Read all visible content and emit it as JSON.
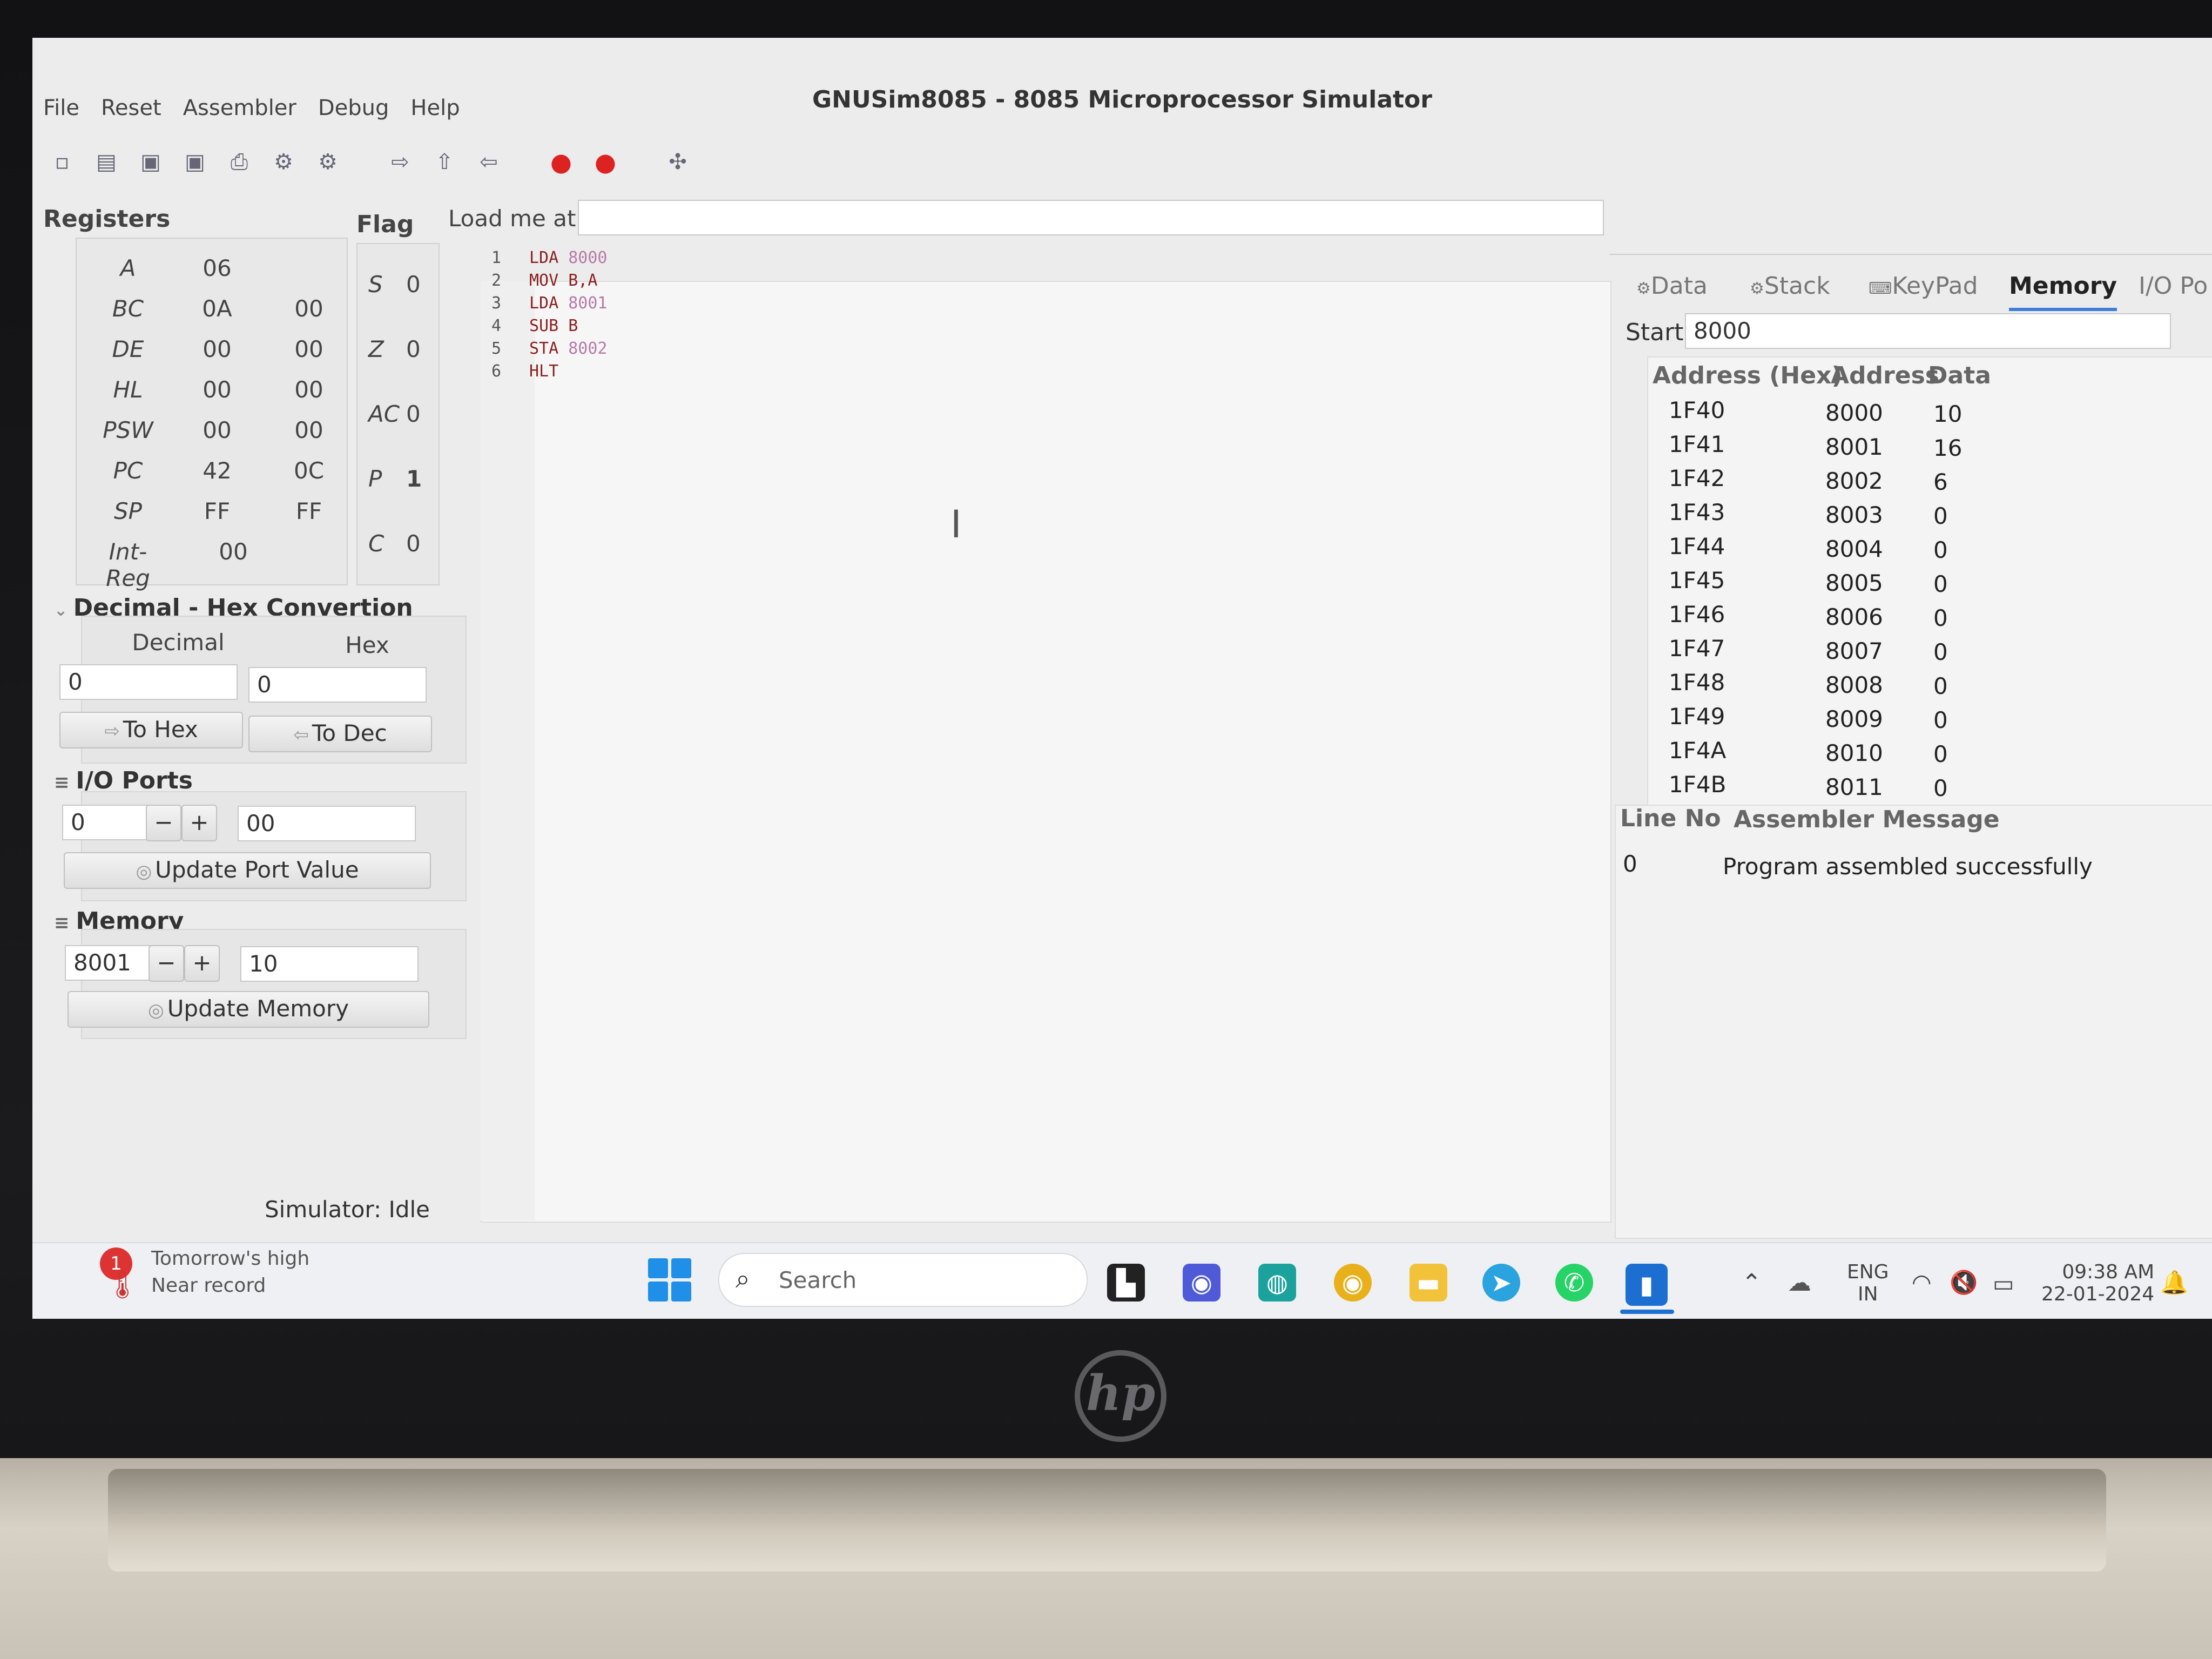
{
  "window": {
    "title": "GNUSim8085 - 8085 Microprocessor Simulator",
    "menu": [
      "File",
      "Reset",
      "Assembler",
      "Debug",
      "Help"
    ]
  },
  "registers": {
    "title": "Registers",
    "rows": [
      {
        "name": "A",
        "v1": "06",
        "v2": ""
      },
      {
        "name": "BC",
        "v1": "0A",
        "v2": "00"
      },
      {
        "name": "DE",
        "v1": "00",
        "v2": "00"
      },
      {
        "name": "HL",
        "v1": "00",
        "v2": "00"
      },
      {
        "name": "PSW",
        "v1": "00",
        "v2": "00"
      },
      {
        "name": "PC",
        "v1": "42",
        "v2": "0C"
      },
      {
        "name": "SP",
        "v1": "FF",
        "v2": "FF"
      },
      {
        "name": "Int-Reg",
        "v1": "00",
        "v2": ""
      }
    ]
  },
  "flags": {
    "title": "Flag",
    "rows": [
      {
        "name": "S",
        "value": "0"
      },
      {
        "name": "Z",
        "value": "0"
      },
      {
        "name": "AC",
        "value": "0"
      },
      {
        "name": "P",
        "value": "1"
      },
      {
        "name": "C",
        "value": "0"
      }
    ]
  },
  "conversion": {
    "title": "Decimal - Hex Convertion",
    "decimal_label": "Decimal",
    "hex_label": "Hex",
    "decimal_value": "0",
    "hex_value": "0",
    "to_hex": "To Hex",
    "to_dec": "To Dec"
  },
  "io_ports": {
    "title": "I/O Ports",
    "port": "0",
    "minus": "−",
    "plus": "+",
    "value": "00",
    "update": "Update Port Value"
  },
  "memory_panel": {
    "title": "Memory",
    "address": "8001",
    "minus": "−",
    "plus": "+",
    "value": "10",
    "update": "Update Memory"
  },
  "editor": {
    "load_label": "Load me at",
    "load_value": "",
    "lines": [
      {
        "n": "1",
        "op": "LDA ",
        "arg": "8000"
      },
      {
        "n": "2",
        "op": "MOV B,A",
        "arg": ""
      },
      {
        "n": "3",
        "op": "LDA ",
        "arg": "8001"
      },
      {
        "n": "4",
        "op": "SUB B",
        "arg": ""
      },
      {
        "n": "5",
        "op": "STA ",
        "arg": "8002"
      },
      {
        "n": "6",
        "op": "HLT",
        "arg": ""
      }
    ]
  },
  "right_tabs": [
    "Data",
    "Stack",
    "KeyPad",
    "Memory",
    "I/O Po"
  ],
  "memory_view": {
    "start_label": "Start",
    "start_value": "8000",
    "headers": [
      "Address (Hex)",
      "Address",
      "Data"
    ],
    "rows": [
      {
        "hex": "1F40",
        "addr": "8000",
        "data": "10"
      },
      {
        "hex": "1F41",
        "addr": "8001",
        "data": "16"
      },
      {
        "hex": "1F42",
        "addr": "8002",
        "data": "6"
      },
      {
        "hex": "1F43",
        "addr": "8003",
        "data": "0"
      },
      {
        "hex": "1F44",
        "addr": "8004",
        "data": "0"
      },
      {
        "hex": "1F45",
        "addr": "8005",
        "data": "0"
      },
      {
        "hex": "1F46",
        "addr": "8006",
        "data": "0"
      },
      {
        "hex": "1F47",
        "addr": "8007",
        "data": "0"
      },
      {
        "hex": "1F48",
        "addr": "8008",
        "data": "0"
      },
      {
        "hex": "1F49",
        "addr": "8009",
        "data": "0"
      },
      {
        "hex": "1F4A",
        "addr": "8010",
        "data": "0"
      },
      {
        "hex": "1F4B",
        "addr": "8011",
        "data": "0"
      }
    ]
  },
  "messages": {
    "headers": [
      "Line No",
      "Assembler Message"
    ],
    "rows": [
      {
        "line": "0",
        "message": "Program assembled successfully"
      }
    ]
  },
  "status": {
    "text": "Simulator: Idle"
  },
  "taskbar": {
    "weather_line1": "Tomorrow's high",
    "weather_line2": "Near record",
    "weather_badge": "1",
    "search_placeholder": "Search",
    "lang_line1": "ENG",
    "lang_line2": "IN",
    "time": "09:38 AM",
    "date": "22-01-2024"
  },
  "laptop": {
    "logo": "hp"
  }
}
